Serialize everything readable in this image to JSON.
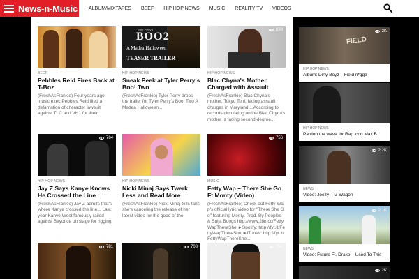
{
  "header": {
    "logo": "News-n-Music",
    "nav": [
      "ALBUM/MIXTAPES",
      "BEEF",
      "HIP HOP NEWS",
      "MUSIC",
      "REALITY TV",
      "VIDEOS"
    ]
  },
  "posts": [
    {
      "category": "BEEF",
      "title": "Pebbles Reid Fires Back at T-Boz",
      "excerpt": "(FreshAsFrankie) Four years ago music exec Pebbles Reid filed a defamation of character lawsuit against TLC and VH1 for their portrayal of...",
      "views": ""
    },
    {
      "category": "HIP HOP NEWS",
      "title": "Sneak Peek at Tyler Perry's Boo! Two",
      "excerpt": "(FreshAsFrankie) Tyler Perry drops the trailer for Tyler Perry's Boo! Two A Madea Halloween...",
      "views": "",
      "thumb_text": [
        "Tyler Perry's",
        "BOO2",
        "A Madea Halloween",
        "TEASER TRAILER"
      ]
    },
    {
      "category": "HIP HOP NEWS",
      "title": "Blac Chyna's Mother Charged with Assault",
      "excerpt": "(FreshAsFrankie) Blac Chyna's mother, Tokyo Toni, facing assault charges in Maryland....According to records circulating online Blac Chyna's mother is facing second-degree...",
      "views": "698"
    },
    {
      "category": "HIP HOP NEWS",
      "title": "Jay Z Says Kanye Knows He Crossed the Line",
      "excerpt": "(FreshAsFrankie) Jay Z admits that's where Kanye crossed the line... Last year Kanye West famously railed against Beyonce on stage for rigging the...",
      "views": "764"
    },
    {
      "category": "HIP HOP NEWS",
      "title": "Nicki Minaj Says Twerk Less and Read More",
      "excerpt": "(FreshAsFrankie) Nicki Minaj tells fans she's canceling the release of her latest video for the good of the community...",
      "views": ""
    },
    {
      "category": "MUSIC",
      "title": "Fetty Wap – There She Go Ft Monty (Video)",
      "excerpt": "(FreshAsFrankie) Check out Fetty Wap's official lyric video for \"There She Go\" featuring Monty. Prod. By Peoples & Sulja Boogs http://www.2lin.cc/FettyWapThereShe ►Spotify: http://fyt.it/FettyWapThereShe ►iTunes: http://fyt.it/FettyWapThereShe...",
      "views": "756"
    },
    {
      "category": "",
      "title": "",
      "excerpt": "",
      "views": "781"
    },
    {
      "category": "",
      "title": "",
      "excerpt": "",
      "views": "708"
    },
    {
      "category": "",
      "title": "",
      "excerpt": "",
      "views": "754"
    }
  ],
  "sidebar": [
    {
      "category": "HIP HOP NEWS",
      "title": "Album: Dirty Boyz – Field n*gga",
      "views": "2K",
      "thumb_text": "FIELD"
    },
    {
      "category": "HIP HOP NEWS",
      "title": "Pardon the wave for Rap icon Max B",
      "views": ""
    },
    {
      "category": "NEWS",
      "title": "Video: Jeezy – G Wagon",
      "views": "2.2K"
    },
    {
      "category": "NEWS",
      "title": "Video: Future Ft. Drake – Used To This",
      "views": "2.1K"
    },
    {
      "category": "",
      "title": "",
      "views": "2K"
    }
  ],
  "colors": {
    "brand": "#e21f26",
    "background": "#000000"
  }
}
